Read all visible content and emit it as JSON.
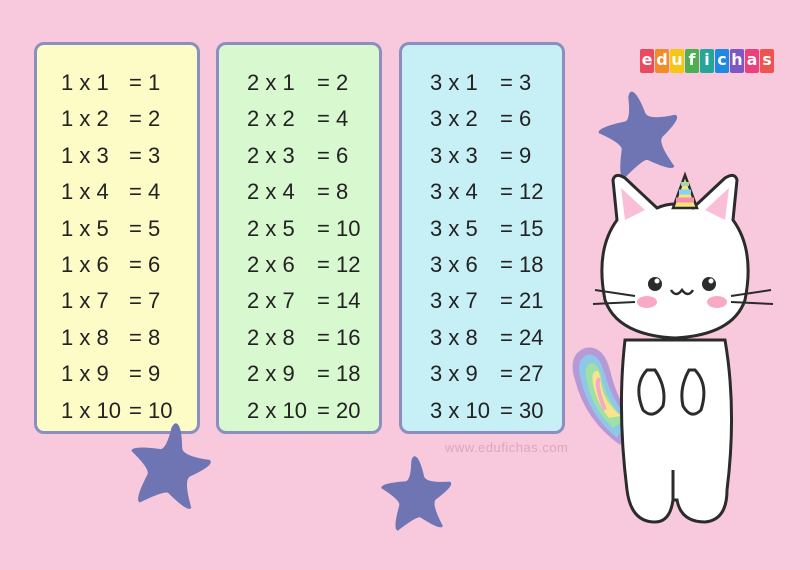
{
  "tables": [
    {
      "rows": [
        {
          "lhs": "1 x 1",
          "rhs": "= 1"
        },
        {
          "lhs": "1 x 2",
          "rhs": "= 2"
        },
        {
          "lhs": "1 x 3",
          "rhs": "= 3"
        },
        {
          "lhs": "1 x 4",
          "rhs": "= 4"
        },
        {
          "lhs": "1 x 5",
          "rhs": "= 5"
        },
        {
          "lhs": "1 x 6",
          "rhs": "= 6"
        },
        {
          "lhs": "1 x 7",
          "rhs": "= 7"
        },
        {
          "lhs": "1 x 8",
          "rhs": "= 8"
        },
        {
          "lhs": "1 x 9",
          "rhs": "= 9"
        },
        {
          "lhs": "1 x 10",
          "rhs": "= 10"
        }
      ]
    },
    {
      "rows": [
        {
          "lhs": "2 x 1",
          "rhs": "= 2"
        },
        {
          "lhs": "2 x 2",
          "rhs": "= 4"
        },
        {
          "lhs": "2 x 3",
          "rhs": "= 6"
        },
        {
          "lhs": "2 x 4",
          "rhs": "= 8"
        },
        {
          "lhs": "2 x 5",
          "rhs": "= 10"
        },
        {
          "lhs": "2 x 6",
          "rhs": "= 12"
        },
        {
          "lhs": "2 x 7",
          "rhs": "= 14"
        },
        {
          "lhs": "2 x 8",
          "rhs": "= 16"
        },
        {
          "lhs": "2 x 9",
          "rhs": "= 18"
        },
        {
          "lhs": "2 x 10",
          "rhs": "= 20"
        }
      ]
    },
    {
      "rows": [
        {
          "lhs": "3 x 1",
          "rhs": "= 3"
        },
        {
          "lhs": "3 x 2",
          "rhs": "= 6"
        },
        {
          "lhs": "3 x 3",
          "rhs": "= 9"
        },
        {
          "lhs": "3 x 4",
          "rhs": "= 12"
        },
        {
          "lhs": "3 x 5",
          "rhs": "= 15"
        },
        {
          "lhs": "3 x 6",
          "rhs": "= 18"
        },
        {
          "lhs": "3 x 7",
          "rhs": "= 21"
        },
        {
          "lhs": "3 x 8",
          "rhs": "= 24"
        },
        {
          "lhs": "3 x 9",
          "rhs": "= 27"
        },
        {
          "lhs": "3 x 10",
          "rhs": "= 30"
        }
      ]
    }
  ],
  "logo": {
    "letters": [
      "e",
      "d",
      "u",
      "f",
      "i",
      "c",
      "h",
      "a",
      "s"
    ],
    "colors": [
      "#e84a5f",
      "#f28c28",
      "#f5c518",
      "#4caf50",
      "#26a69a",
      "#1e88e5",
      "#7e57c2",
      "#ec407a",
      "#ef5350"
    ]
  },
  "watermark": "www.edufichas.com",
  "colors": {
    "background": "#f8c9dc",
    "star": "#6f74b3",
    "card_yellow": "#fdfcc6",
    "card_green": "#d8f8cf",
    "card_blue": "#c7eff6",
    "card_border": "#8a8fc0"
  },
  "decor": {
    "stars": [
      "star-icon",
      "star-icon",
      "star-icon",
      "star-icon"
    ],
    "mascot": "unicorn-cat"
  }
}
